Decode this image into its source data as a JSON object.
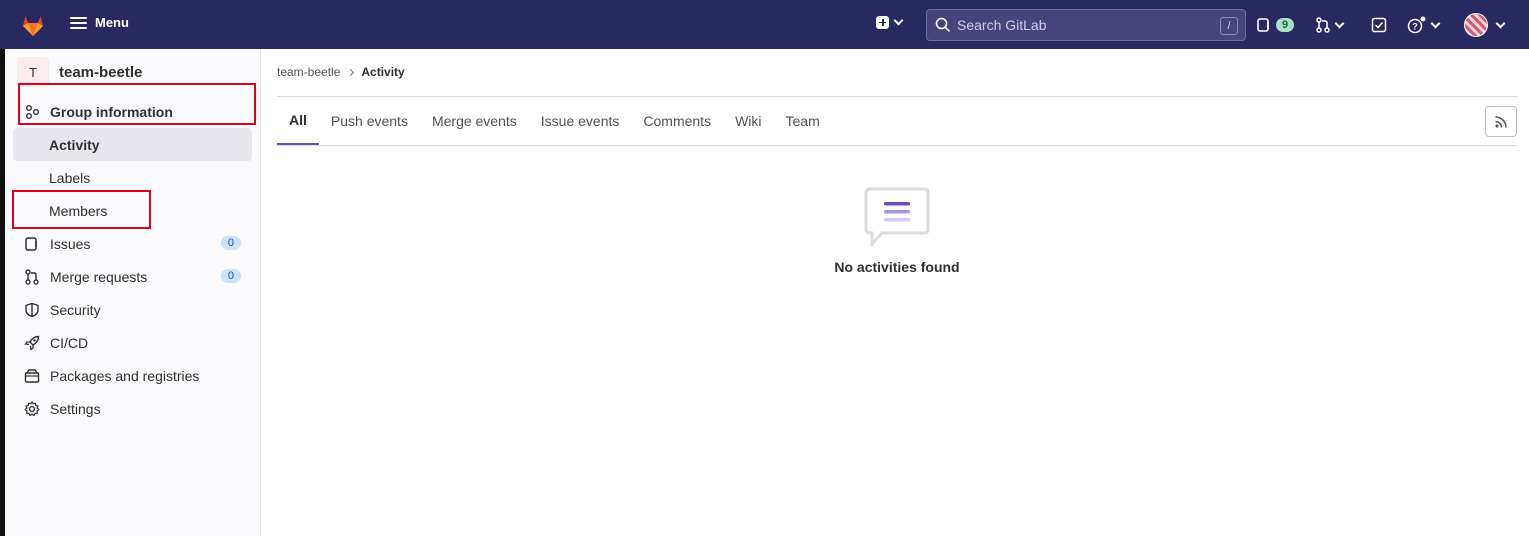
{
  "topbar": {
    "menu_label": "Menu",
    "search_placeholder": "Search GitLab",
    "search_shortcut": "/",
    "issues_count": "9",
    "icons": [
      "gitlab-logo",
      "hamburger-icon",
      "plus-square-icon",
      "search-icon",
      "issues-icon",
      "merge-request-icon",
      "todo-icon",
      "help-icon",
      "avatar"
    ]
  },
  "sidebar": {
    "group_initial": "T",
    "group_name": "team-beetle",
    "items": [
      {
        "label": "Group information",
        "icon": "group-info-icon"
      },
      {
        "label": "Activity"
      },
      {
        "label": "Labels"
      },
      {
        "label": "Members"
      },
      {
        "label": "Issues",
        "icon": "issues-icon",
        "badge": "0"
      },
      {
        "label": "Merge requests",
        "icon": "merge-request-icon",
        "badge": "0"
      },
      {
        "label": "Security",
        "icon": "shield-icon"
      },
      {
        "label": "CI/CD",
        "icon": "rocket-icon"
      },
      {
        "label": "Packages and registries",
        "icon": "package-icon"
      },
      {
        "label": "Settings",
        "icon": "gear-icon"
      }
    ]
  },
  "breadcrumb": {
    "parent": "team-beetle",
    "current": "Activity"
  },
  "tabs": [
    "All",
    "Push events",
    "Merge events",
    "Issue events",
    "Comments",
    "Wiki",
    "Team"
  ],
  "empty_state": {
    "title": "No activities found"
  },
  "colors": {
    "topbar": "#292961",
    "accent": "#6e49cb",
    "highlight_box": "#e0001b"
  }
}
